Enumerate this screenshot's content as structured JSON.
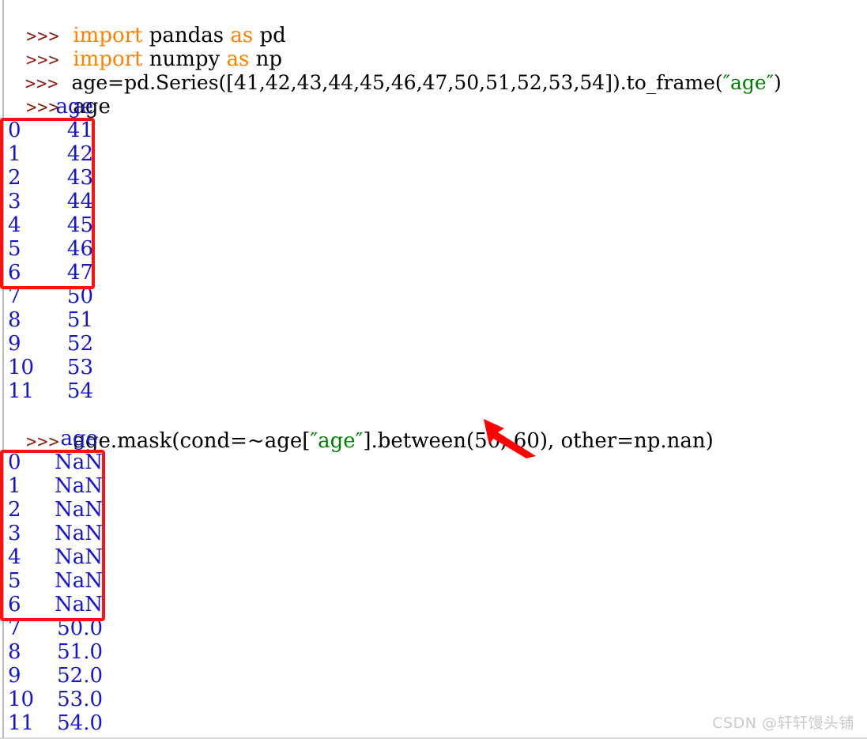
{
  "console": {
    "prompt": ">>>",
    "lines": [
      {
        "type": "code",
        "prompt": ">>>",
        "segments": [
          {
            "text": "import",
            "style": "kw"
          },
          {
            "text": " pandas ",
            "style": "plain"
          },
          {
            "text": "as",
            "style": "kw"
          },
          {
            "text": " pd",
            "style": "plain"
          }
        ]
      },
      {
        "type": "code",
        "prompt": ">>>",
        "segments": [
          {
            "text": "import",
            "style": "kw"
          },
          {
            "text": " numpy ",
            "style": "plain"
          },
          {
            "text": "as",
            "style": "kw"
          },
          {
            "text": " np",
            "style": "plain"
          }
        ]
      },
      {
        "type": "code",
        "prompt": ">>>",
        "segments": [
          {
            "text": "age=pd.Series([41,42,43,44,45,46,47,50,51,52,53,54]).to_frame(",
            "style": "plain"
          },
          {
            "text": "″age″",
            "style": "str"
          },
          {
            "text": ")",
            "style": "plain"
          }
        ]
      },
      {
        "type": "code",
        "prompt": ">>>",
        "segments": [
          {
            "text": "age",
            "style": "plain"
          }
        ]
      }
    ],
    "mask_line": {
      "prompt": ">>>",
      "segments": [
        {
          "text": "age.mask(cond=~age[",
          "style": "plain"
        },
        {
          "text": "″age″",
          "style": "str"
        },
        {
          "text": "].between(50, 60), other=np.nan)",
          "style": "plain"
        }
      ]
    }
  },
  "table_age": {
    "header": "age",
    "index_label": "",
    "rows": [
      {
        "index": "0",
        "age": "41"
      },
      {
        "index": "1",
        "age": "42"
      },
      {
        "index": "2",
        "age": "43"
      },
      {
        "index": "3",
        "age": "44"
      },
      {
        "index": "4",
        "age": "45"
      },
      {
        "index": "5",
        "age": "46"
      },
      {
        "index": "6",
        "age": "47"
      },
      {
        "index": "7",
        "age": "50"
      },
      {
        "index": "8",
        "age": "51"
      },
      {
        "index": "9",
        "age": "52"
      },
      {
        "index": "10",
        "age": "53"
      },
      {
        "index": "11",
        "age": "54"
      }
    ]
  },
  "table_masked": {
    "header": "age",
    "rows": [
      {
        "index": "0",
        "age": "NaN"
      },
      {
        "index": "1",
        "age": "NaN"
      },
      {
        "index": "2",
        "age": "NaN"
      },
      {
        "index": "3",
        "age": "NaN"
      },
      {
        "index": "4",
        "age": "NaN"
      },
      {
        "index": "5",
        "age": "NaN"
      },
      {
        "index": "6",
        "age": "NaN"
      },
      {
        "index": "7",
        "age": "50.0"
      },
      {
        "index": "8",
        "age": "51.0"
      },
      {
        "index": "9",
        "age": "52.0"
      },
      {
        "index": "10",
        "age": "53.0"
      },
      {
        "index": "11",
        "age": "54.0"
      }
    ]
  },
  "annotations": {
    "highlight_color": "#ff1111",
    "arrow_color": "#ff0000",
    "arrow_target_text": "60",
    "box1_label": "rows-0-to-6-original",
    "box2_label": "rows-0-to-6-masked"
  },
  "colors": {
    "keyword": "#ff7f00",
    "string": "#008000",
    "output": "#1414d2",
    "prompt": "#8b1a10",
    "plain": "#000000",
    "watermark": "#c9c9c9"
  },
  "watermark": {
    "text": "CSDN @轩轩馒头铺"
  }
}
